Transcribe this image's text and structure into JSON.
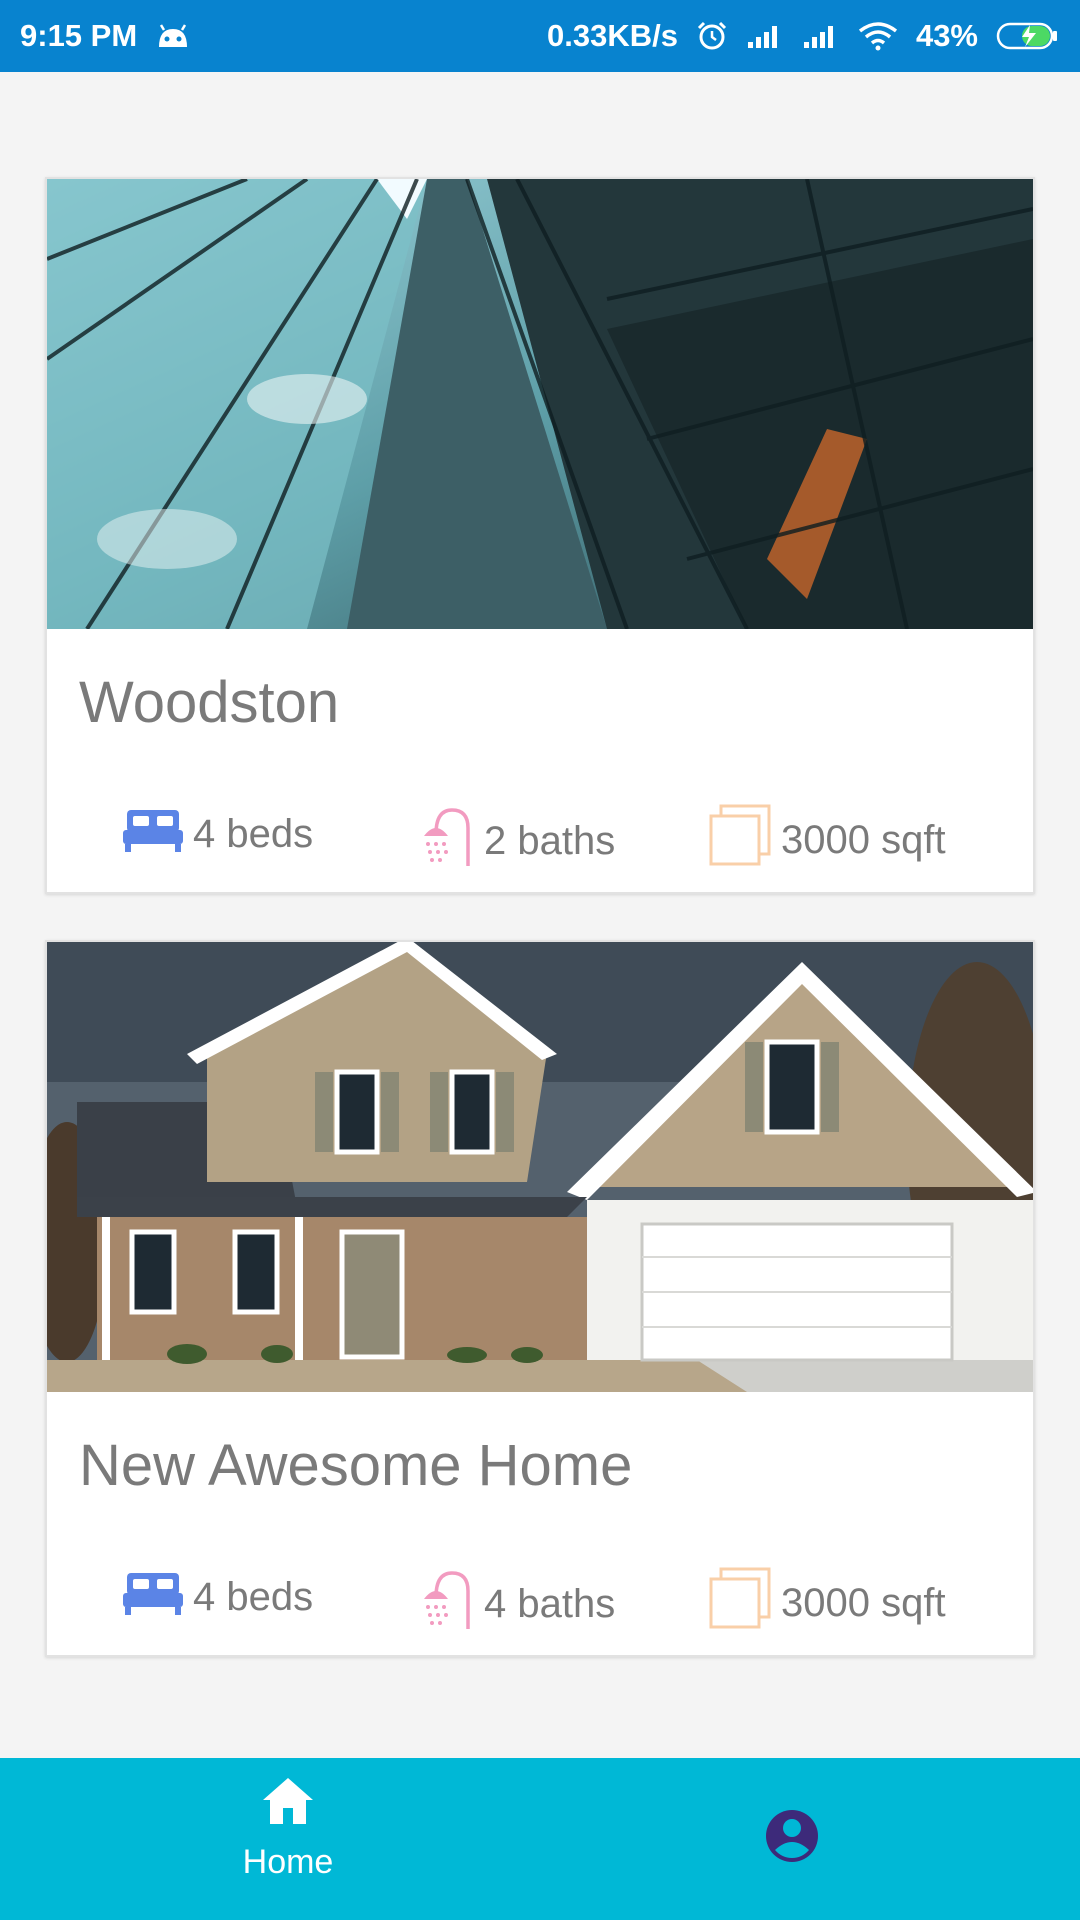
{
  "status_bar": {
    "time": "9:15 PM",
    "network_speed": "0.33KB/s",
    "battery": "43%",
    "icons": [
      "android-icon",
      "alarm-icon",
      "signal-icon",
      "signal-icon",
      "wifi-icon",
      "battery-charging-icon"
    ]
  },
  "listings": [
    {
      "title": "Woodston",
      "image": "glass-skyscrapers-photo",
      "beds": "4 beds",
      "baths": "2 baths",
      "area": "3000 sqft"
    },
    {
      "title": "New Awesome Home",
      "image": "suburban-house-photo",
      "beds": "4 beds",
      "baths": "4 baths",
      "area": "3000 sqft"
    }
  ],
  "bottom_nav": {
    "home_label": "Home",
    "home_icon": "home-icon",
    "profile_icon": "account-circle-icon"
  },
  "colors": {
    "status_bar": "#0883cf",
    "bottom_nav": "#00b8d6",
    "bed_icon": "#5b84e6",
    "bath_icon": "#f29bc0",
    "area_icon": "#f9cfa8",
    "profile_icon": "#3d2a7a"
  }
}
